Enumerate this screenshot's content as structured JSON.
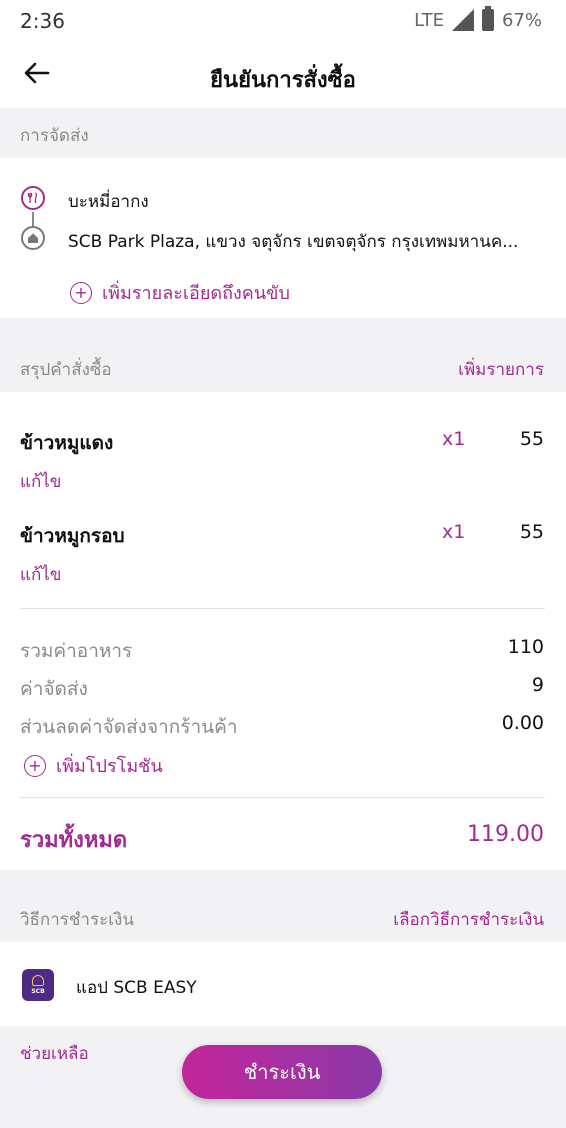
{
  "status_bar": {
    "time": "2:36",
    "network": "LTE",
    "battery": "67%"
  },
  "app_bar": {
    "title": "ยืนยันการสั่งซื้อ",
    "back_icon": "arrow-left-icon"
  },
  "delivery": {
    "section_label": "การจัดส่ง",
    "restaurant_name": "บะหมี่อากง",
    "address": "SCB Park Plaza, แขวง จตุจักร เขตจตุจักร กรุงเทพมหานค...",
    "add_note_label": "เพิ่มรายละเอียดถึงคนขับ"
  },
  "order": {
    "section_label": "สรุปคำสั่งซื้อ",
    "add_item_label": "เพิ่มรายการ",
    "items": [
      {
        "name": "ข้าวหมูแดง",
        "qty": "x1",
        "price": "55",
        "edit_label": "แก้ไข"
      },
      {
        "name": "ข้าวหมูกรอบ",
        "qty": "x1",
        "price": "55",
        "edit_label": "แก้ไข"
      }
    ],
    "summary": {
      "food_total_label": "รวมค่าอาหาร",
      "food_total": "110",
      "delivery_fee_label": "ค่าจัดส่ง",
      "delivery_fee": "9",
      "discount_label": "ส่วนลดค่าจัดส่งจากร้านค้า",
      "discount": "0.00",
      "add_promo_label": "เพิ่มโปรโมชัน"
    },
    "grand_total_label": "รวมทั้งหมด",
    "grand_total": "119.00"
  },
  "payment": {
    "section_label": "วิธีการชำระเงิน",
    "choose_label": "เลือกวิธีการชำระเงิน",
    "method_name": "แอป SCB EASY",
    "logo_text": "SCB"
  },
  "footer": {
    "help_label": "ช่วยเหลือ",
    "pay_button_label": "ชำระเงิน"
  },
  "colors": {
    "accent": "#a32a8f",
    "button_start": "#c3259a",
    "button_end": "#8a3aa8"
  }
}
